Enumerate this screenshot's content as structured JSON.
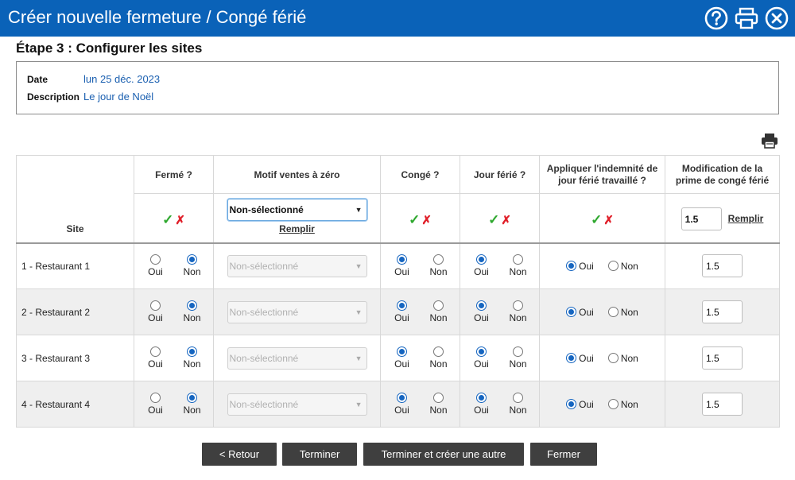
{
  "window": {
    "title": "Créer nouvelle fermeture / Congé férié"
  },
  "step": {
    "title": "Étape 3 : Configurer les sites"
  },
  "info": {
    "date_label": "Date",
    "date_value": "lun 25 déc. 2023",
    "description_label": "Description",
    "description_value": "Le jour de Noël"
  },
  "table": {
    "headers": {
      "site": "Site",
      "ferme": "Fermé ?",
      "motif": "Motif ventes à zéro",
      "conge": "Congé ?",
      "jour_ferie": "Jour férié ?",
      "indemnite": "Appliquer l'indemnité de jour férié travaillé ?",
      "prime": "Modification de la prime de congé férié"
    },
    "bulk": {
      "motif_selected": "Non-sélectionné",
      "remplir_label": "Remplir",
      "prime_value": "1.5"
    },
    "radio_labels": {
      "oui": "Oui",
      "non": "Non"
    },
    "rows": [
      {
        "site": "1 - Restaurant 1",
        "motif": "Non-sélectionné",
        "ferme": "Non",
        "conge": "Oui",
        "jour_ferie": "Oui",
        "indemnite": "Oui",
        "prime": "1.5"
      },
      {
        "site": "2 - Restaurant 2",
        "motif": "Non-sélectionné",
        "ferme": "Non",
        "conge": "Oui",
        "jour_ferie": "Oui",
        "indemnite": "Oui",
        "prime": "1.5"
      },
      {
        "site": "3 - Restaurant 3",
        "motif": "Non-sélectionné",
        "ferme": "Non",
        "conge": "Oui",
        "jour_ferie": "Oui",
        "indemnite": "Oui",
        "prime": "1.5"
      },
      {
        "site": "4 - Restaurant 4",
        "motif": "Non-sélectionné",
        "ferme": "Non",
        "conge": "Oui",
        "jour_ferie": "Oui",
        "indemnite": "Oui",
        "prime": "1.5"
      }
    ]
  },
  "buttons": {
    "retour": "< Retour",
    "terminer": "Terminer",
    "terminer_autre": "Terminer et créer une autre",
    "fermer": "Fermer"
  },
  "icons": {
    "help": "help-icon",
    "print": "print-icon",
    "close": "close-icon",
    "check": "✓",
    "cross": "✗"
  },
  "colors": {
    "titlebar": "#0a62b8",
    "link_value": "#1a5fb0",
    "radio_selected": "#1565c0",
    "check_green": "#2ea82e",
    "cross_red": "#e0202a",
    "button_dark": "#3f3f3f"
  }
}
